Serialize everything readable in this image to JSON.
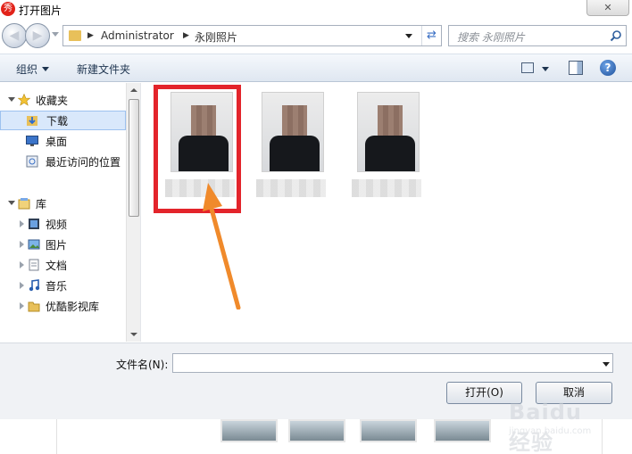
{
  "titlebar": {
    "title": "打开图片",
    "app_icon": "秀",
    "close": "✕"
  },
  "address": {
    "crumbs": [
      "Administrator",
      "永刚照片"
    ],
    "search_placeholder": "搜索 永刚照片"
  },
  "toolbar": {
    "organize": "组织",
    "new_folder": "新建文件夹",
    "help": "?"
  },
  "sidebar": {
    "favorites": "收藏夹",
    "favorites_items": [
      "下载",
      "桌面",
      "最近访问的位置"
    ],
    "library": "库",
    "library_items": [
      "视频",
      "图片",
      "文档",
      "音乐",
      "优酷影视库"
    ]
  },
  "files": [
    {
      "icon": "photo-thumbnail",
      "selected": true
    },
    {
      "icon": "photo-thumbnail",
      "selected": false
    },
    {
      "icon": "photo-thumbnail",
      "selected": false
    }
  ],
  "annotation": {
    "highlight_color": "#e3242b",
    "arrow_color": "#f08a2b"
  },
  "bottom": {
    "filename_label": "文件名(N):",
    "filename_value": "",
    "open_button": "打开(O)",
    "cancel_button": "取消"
  },
  "watermark": {
    "text": "Baidu经验",
    "sub": "jingyan.baidu.com"
  }
}
